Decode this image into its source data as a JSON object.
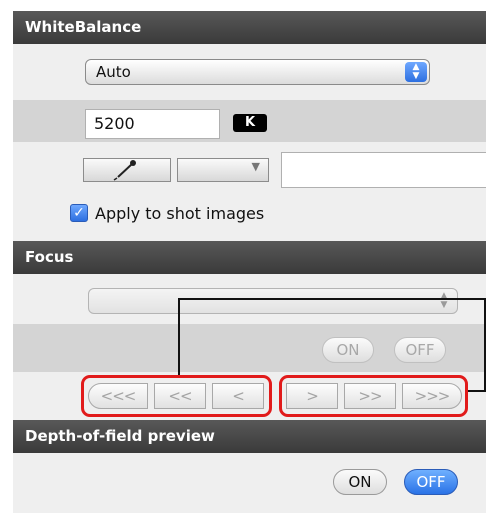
{
  "white_balance": {
    "header": "WhiteBalance",
    "preset_value": "Auto",
    "kelvin_value": "5200",
    "kelvin_badge": "K",
    "wb_dropdown_value": "",
    "apply_checkbox_label": "Apply to shot images",
    "apply_checked": true
  },
  "focus": {
    "header": "Focus",
    "select_value": "",
    "on_label": "ON",
    "off_label": "OFF",
    "nav_left": [
      "<<<",
      "<<",
      "<"
    ],
    "nav_right": [
      ">",
      ">>",
      ">>>"
    ]
  },
  "dof": {
    "header": "Depth-of-field preview",
    "on_label": "ON",
    "off_label": "OFF",
    "active": "OFF"
  },
  "colors": {
    "header_bg": "#4a4a4a",
    "accent_blue": "#2d6fe0",
    "callout_red": "#e11b1b"
  }
}
